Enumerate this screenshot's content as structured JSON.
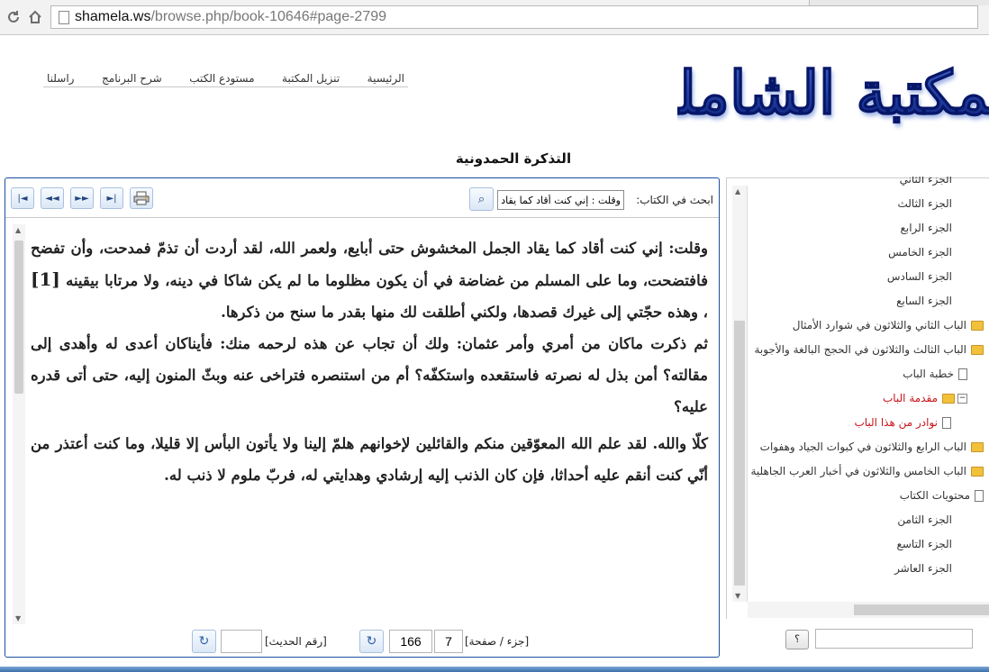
{
  "browser": {
    "url_host": "shamela.ws",
    "url_path": "/browse.php/book-10646#page-2799"
  },
  "header": {
    "nav": [
      "الرئيسية",
      "تنزيل المكتبة",
      "مستودع الكتب",
      "شرح البرنامج",
      "راسلنا"
    ],
    "logo_text": "المكتبة الشاملة",
    "book_title": "التذكرة الحمدونية"
  },
  "toolbar": {
    "search_label": "ابحث في الكتاب:",
    "search_value": "وقلت : إني كنت أقاد كما يقاد"
  },
  "content": {
    "p1a": "وقلت: إني كنت أقاد كما يقاد الجمل المخشوش حتى أبايع، ولعمر الله، لقد أردت أن تذمّ فمدحت، وأن تفضح فافتضحت، وما على المسلم من غضاضة في أن يكون مظلوما ما لم يكن شاكا في دينه، ولا مرتابا بيقينه",
    "footnote": "[1]",
    "p1b": "، وهذه حجّتي إلى غيرك قصدها، ولكني أطلقت لك منها بقدر ما سنح من ذكرها.",
    "p2": "ثم ذكرت ماكان من أمري وأمر عثمان: ولك أن تجاب عن هذه لرحمه منك: فأيناكان أعدى له وأهدى إلى مقالته؟ أمن بذل له نصرته فاستقعده واستكفّه؟ أم من استنصره فتراخى عنه وبثّ المنون إليه، حتى أتى قدره عليه؟",
    "p3": "كلّا والله. لقد علم الله المعوّقين منكم والقائلين لإخوانهم هلمّ إلينا ولا يأتون البأس إلا قليلا، وما كنت أعتذر من أنّي كنت أنقم عليه أحداثا، فإن كان الذنب إليه إرشادي وهدايتي له، فربّ ملوم لا ذنب له."
  },
  "pager": {
    "label": "[جزء / صفحة]",
    "part": "7",
    "page": "166",
    "hadith_label": "[رقم الحديث]",
    "hadith_value": ""
  },
  "tree": {
    "items": [
      {
        "label": "الجزء الثاني",
        "kind": "none",
        "indent": 0
      },
      {
        "label": "الجزء الثالث",
        "kind": "none",
        "indent": 0
      },
      {
        "label": "الجزء الرابع",
        "kind": "none",
        "indent": 0
      },
      {
        "label": "الجزء الخامس",
        "kind": "none",
        "indent": 0
      },
      {
        "label": "الجزء السادس",
        "kind": "none",
        "indent": 0
      },
      {
        "label": "الجزء السابع",
        "kind": "none",
        "indent": 0
      },
      {
        "label": "الباب الثاني والثلاثون في شوارد الأمثال",
        "kind": "folder",
        "indent": 1
      },
      {
        "label": "الباب الثالث والثلاثون في الحجج البالغة والأجوبة",
        "kind": "folder",
        "indent": 1
      },
      {
        "label": "خطبة الباب",
        "kind": "page",
        "indent": 2
      },
      {
        "label": "مقدمة الباب",
        "kind": "folder-open",
        "indent": 2,
        "red": true
      },
      {
        "label": "نوادر من هذا الباب",
        "kind": "page",
        "indent": 3,
        "red": true
      },
      {
        "label": "الباب الرابع والثلاثون في كبوات الجياد وهفوات",
        "kind": "folder",
        "indent": 1
      },
      {
        "label": "الباب الخامس والثلاثون في أخبار العرب الجاهلية",
        "kind": "folder",
        "indent": 1
      },
      {
        "label": "محتويات الكتاب",
        "kind": "page",
        "indent": 1
      },
      {
        "label": "الجزء الثامن",
        "kind": "none",
        "indent": 0
      },
      {
        "label": "الجزء التاسع",
        "kind": "none",
        "indent": 0
      },
      {
        "label": "الجزء العاشر",
        "kind": "none",
        "indent": 0
      }
    ],
    "search_button": "؟"
  }
}
